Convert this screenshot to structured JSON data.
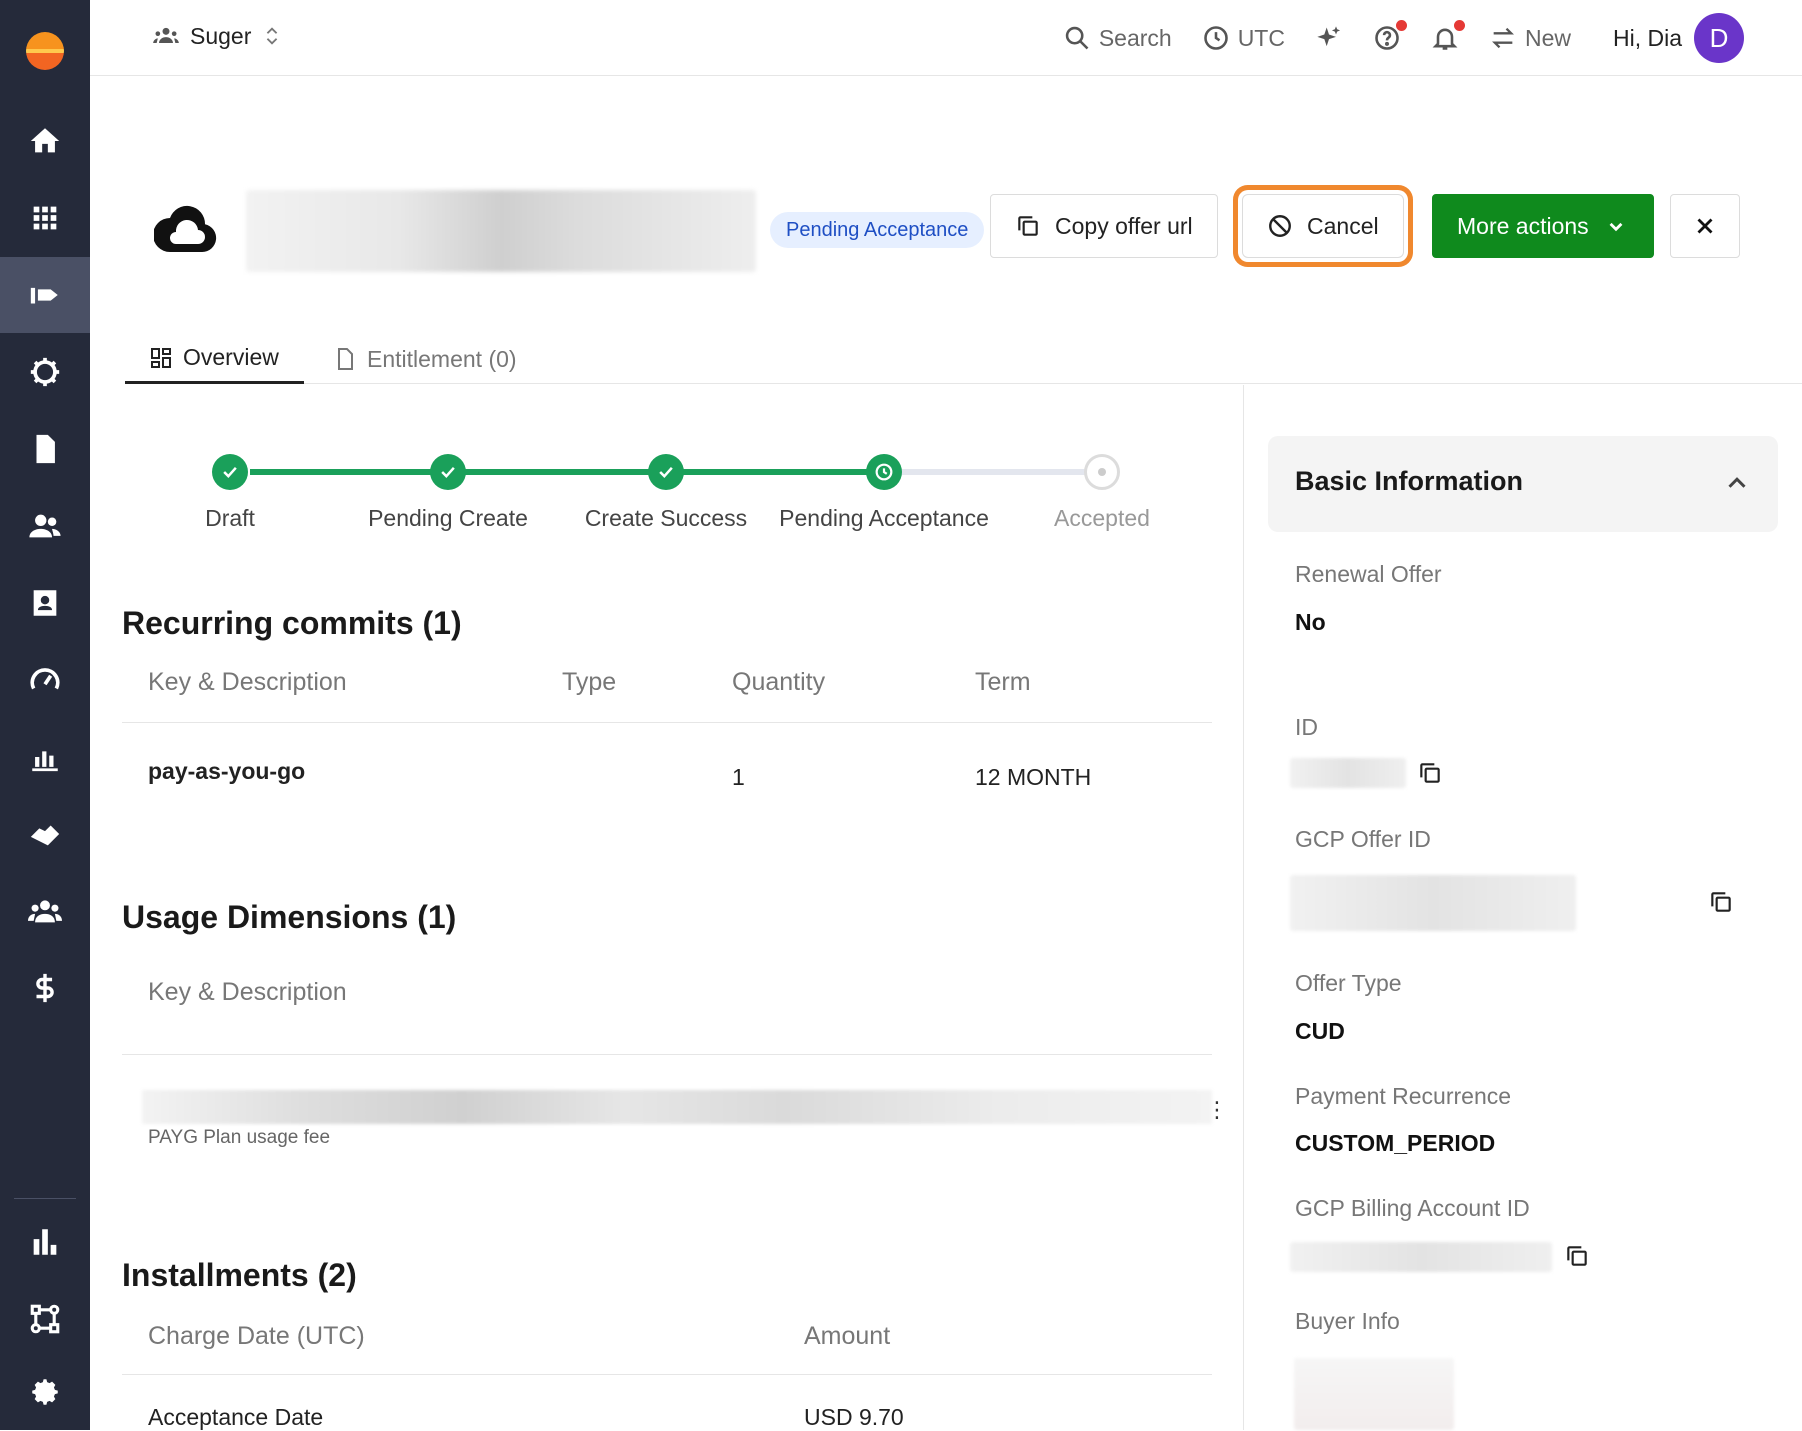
{
  "topbar": {
    "org_name": "Suger",
    "search_label": "Search",
    "timezone_label": "UTC",
    "new_label": "New",
    "greeting": "Hi, Dia",
    "avatar_initial": "D"
  },
  "sidebar": {
    "items": [
      "home",
      "apps",
      "offers",
      "integrations",
      "documents",
      "customers",
      "contacts",
      "metering",
      "revenue",
      "deals",
      "partners",
      "billing",
      "analytics",
      "workflows",
      "settings"
    ],
    "active": "offers"
  },
  "offer": {
    "status": "Pending Acceptance",
    "copy_url_label": "Copy offer url",
    "cancel_label": "Cancel",
    "more_actions_label": "More actions"
  },
  "tabs": [
    {
      "label": "Overview",
      "active": true
    },
    {
      "label": "Entitlement (0)",
      "active": false
    }
  ],
  "stepper": {
    "steps": [
      {
        "label": "Draft",
        "state": "done"
      },
      {
        "label": "Pending Create",
        "state": "done"
      },
      {
        "label": "Create Success",
        "state": "done"
      },
      {
        "label": "Pending Acceptance",
        "state": "current"
      },
      {
        "label": "Accepted",
        "state": "todo"
      }
    ]
  },
  "recurring": {
    "title": "Recurring commits (1)",
    "headers": [
      "Key & Description",
      "Type",
      "Quantity",
      "Term"
    ],
    "rows": [
      {
        "key": "pay-as-you-go",
        "type": "",
        "quantity": "1",
        "term": "12 MONTH"
      }
    ]
  },
  "usage": {
    "title": "Usage Dimensions (1)",
    "header": "Key & Description",
    "row_description": "PAYG Plan usage fee"
  },
  "installments": {
    "title": "Installments (2)",
    "headers": [
      "Charge Date (UTC)",
      "Amount"
    ],
    "rows": [
      {
        "date": "Acceptance Date",
        "amount": "USD 9.70"
      }
    ]
  },
  "basic_info": {
    "title": "Basic Information",
    "renewal_label": "Renewal Offer",
    "renewal_value": "No",
    "id_label": "ID",
    "gcp_offer_id_label": "GCP Offer ID",
    "offer_type_label": "Offer Type",
    "offer_type_value": "CUD",
    "payment_recurrence_label": "Payment Recurrence",
    "payment_recurrence_value": "CUSTOM_PERIOD",
    "billing_account_label": "GCP Billing Account ID",
    "buyer_info_label": "Buyer Info"
  },
  "colors": {
    "sidebar_bg": "#252a3a",
    "accent_green": "#0f8a1d",
    "step_green": "#1aa05a",
    "pill_blue": "#1f4fc4",
    "highlight_orange": "#f0882e",
    "avatar_purple": "#6a35c9"
  }
}
